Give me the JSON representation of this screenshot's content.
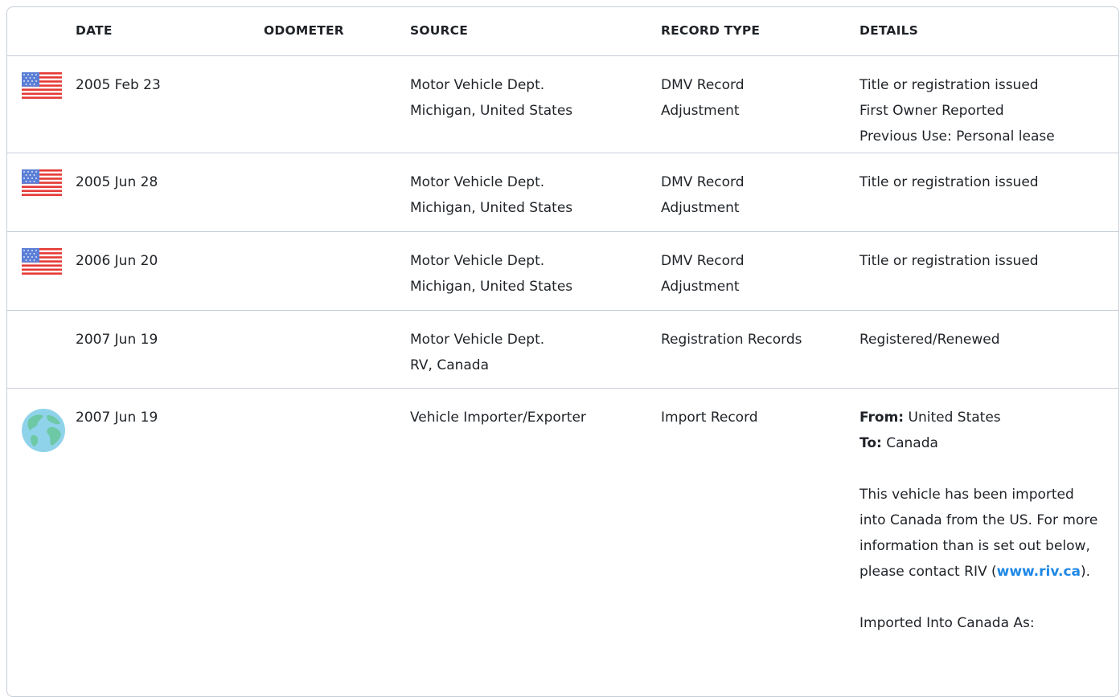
{
  "headers": {
    "date": "DATE",
    "odometer": "ODOMETER",
    "source": "SOURCE",
    "record_type": "RECORD TYPE",
    "details": "DETAILS"
  },
  "rows": [
    {
      "icon": "us-flag-icon",
      "date": "2005 Feb 23",
      "source": [
        "Motor Vehicle Dept.",
        "Michigan, United States"
      ],
      "type": [
        "DMV Record",
        "Adjustment"
      ],
      "details": [
        "Title or registration issued",
        "First Owner Reported",
        "Previous Use: Personal lease"
      ]
    },
    {
      "icon": "us-flag-icon",
      "date": "2005 Jun 28",
      "source": [
        "Motor Vehicle Dept.",
        "Michigan, United States"
      ],
      "type": [
        "DMV Record",
        "Adjustment"
      ],
      "details": [
        "Title or registration issued"
      ]
    },
    {
      "icon": "us-flag-icon",
      "date": "2006 Jun 20",
      "source": [
        "Motor Vehicle Dept.",
        "Michigan, United States"
      ],
      "type": [
        "DMV Record",
        "Adjustment"
      ],
      "details": [
        "Title or registration issued"
      ]
    },
    {
      "icon": "",
      "date": "2007 Jun 19",
      "source": [
        "Motor Vehicle Dept.",
        "RV, Canada"
      ],
      "type": [
        "Registration Records"
      ],
      "details": [
        "Registered/Renewed"
      ]
    },
    {
      "icon": "globe-icon",
      "date": "2007 Jun 19",
      "source": [
        "Vehicle Importer/Exporter"
      ],
      "type": [
        "Import Record"
      ],
      "import_details": {
        "from_label": "From:",
        "from_value": " United States",
        "to_label": "To:",
        "to_value": " Canada",
        "paragraph_before_link": "This vehicle has been imported into Canada from the US. For more information than is set out below, please contact RIV (",
        "link_text": "www.riv.ca",
        "paragraph_after_link": ").",
        "imported_as": "Imported Into Canada As:"
      }
    }
  ],
  "colors": {
    "border": "#c7ced6",
    "link": "#1e88e5",
    "text": "#1f2328"
  }
}
